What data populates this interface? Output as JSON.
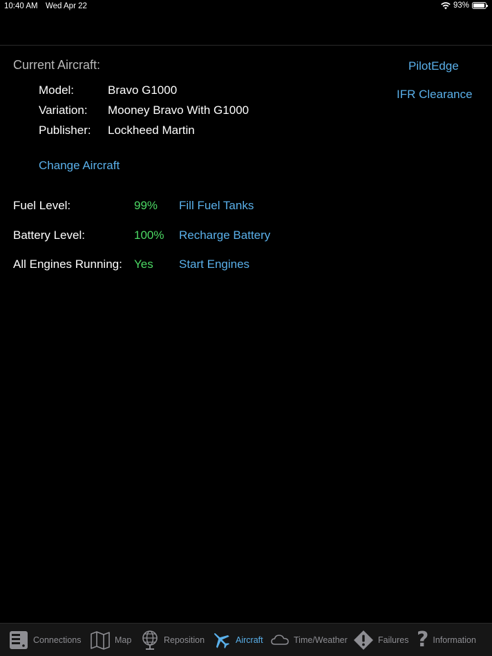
{
  "status_bar": {
    "time": "10:40 AM",
    "date": "Wed Apr 22",
    "battery": "93%",
    "battery_fraction": 0.93,
    "wifi_icon": "wifi-icon"
  },
  "current_aircraft": {
    "title": "Current Aircraft:",
    "model_label": "Model:",
    "model_value": "Bravo G1000",
    "variation_label": "Variation:",
    "variation_value": "Mooney Bravo With G1000",
    "publisher_label": "Publisher:",
    "publisher_value": "Lockheed Martin",
    "change_link": "Change Aircraft"
  },
  "side_links": {
    "pilotedge": "PilotEdge",
    "ifr": "IFR Clearance"
  },
  "systems": [
    {
      "label": "Fuel Level:",
      "value": "99%",
      "action": "Fill Fuel Tanks"
    },
    {
      "label": "Battery Level:",
      "value": "100%",
      "action": "Recharge Battery"
    },
    {
      "label": "All Engines Running:",
      "value": "Yes",
      "action": "Start Engines"
    }
  ],
  "tabs": [
    {
      "label": "Connections",
      "icon": "server-icon"
    },
    {
      "label": "Map",
      "icon": "map-icon"
    },
    {
      "label": "Reposition",
      "icon": "globe-icon"
    },
    {
      "label": "Aircraft",
      "icon": "airplane-icon",
      "active": true
    },
    {
      "label": "Time/Weather",
      "icon": "cloud-icon"
    },
    {
      "label": "Failures",
      "icon": "warning-icon"
    },
    {
      "label": "Information",
      "icon": "question-icon"
    }
  ],
  "colors": {
    "accent": "#5ab0ea",
    "ok": "#4cd964",
    "background": "#000000",
    "tab_inactive": "#8e8e93"
  }
}
